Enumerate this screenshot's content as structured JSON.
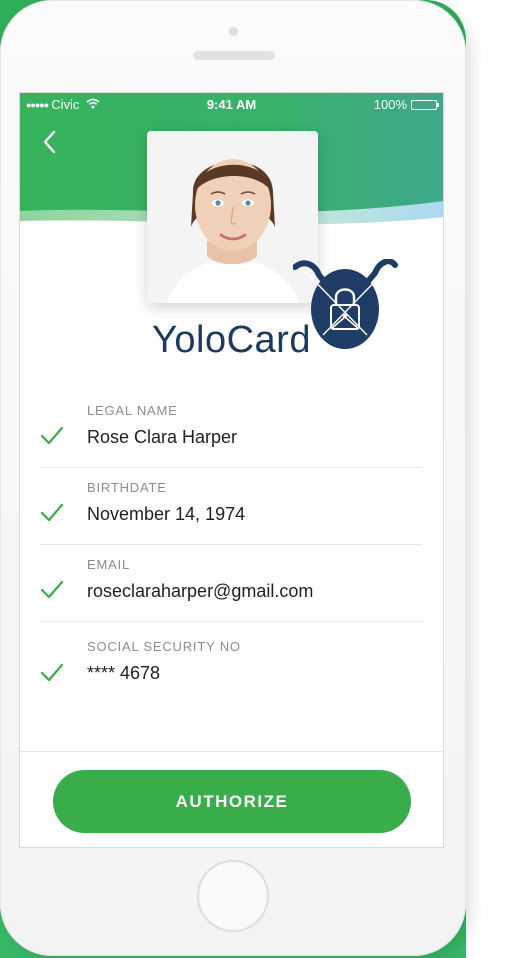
{
  "status_bar": {
    "carrier_dots": "●●●●●",
    "carrier": "Civic",
    "time": "9:41 AM",
    "battery_percent": "100%"
  },
  "header": {
    "back_icon": "chevron-left-icon",
    "photo_icon": "profile-photo"
  },
  "brand": {
    "name": "YoloCard",
    "badge_icon": "lock-emblem-icon"
  },
  "fields": [
    {
      "label": "LEGAL NAME",
      "value": "Rose Clara Harper"
    },
    {
      "label": "BIRTHDATE",
      "value": "November 14, 1974"
    },
    {
      "label": "EMAIL",
      "value": "roseclaraharper@gmail.com"
    },
    {
      "label": "SOCIAL SECURITY NO",
      "value": "**** 4678"
    }
  ],
  "action": {
    "authorize_label": "AUTHORIZE"
  },
  "colors": {
    "accent_green": "#3aad4b",
    "check_green": "#3aad4b",
    "brand_navy": "#1c3a5e",
    "header_green": "#2fae5a"
  }
}
